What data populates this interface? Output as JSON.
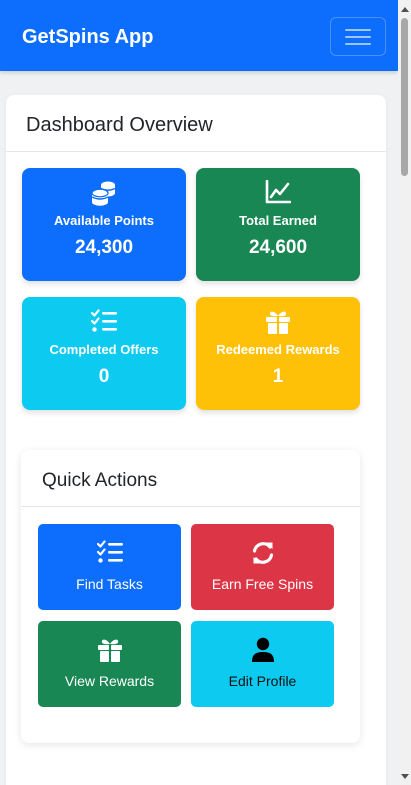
{
  "navbar": {
    "brand": "GetSpins App",
    "bg_color": "#0d6efd"
  },
  "dashboard": {
    "title": "Dashboard Overview",
    "stats": [
      {
        "label": "Available Points",
        "value": "24,300",
        "icon": "coins-icon",
        "color": "#0d6efd"
      },
      {
        "label": "Total Earned",
        "value": "24,600",
        "icon": "chart-line-icon",
        "color": "#198754"
      },
      {
        "label": "Completed Offers",
        "value": "0",
        "icon": "list-check-icon",
        "color": "#0dcaf0"
      },
      {
        "label": "Redeemed Rewards",
        "value": "1",
        "icon": "gift-icon",
        "color": "#ffc107"
      }
    ]
  },
  "quick_actions": {
    "title": "Quick Actions",
    "buttons": [
      {
        "label": "Find Tasks",
        "icon": "list-check-icon",
        "color": "#0d6efd"
      },
      {
        "label": "Earn Free Spins",
        "icon": "refresh-icon",
        "color": "#dc3545"
      },
      {
        "label": "View Rewards",
        "icon": "gift-icon",
        "color": "#198754"
      },
      {
        "label": "Edit Profile",
        "icon": "user-icon",
        "color": "#0dcaf0"
      }
    ]
  }
}
